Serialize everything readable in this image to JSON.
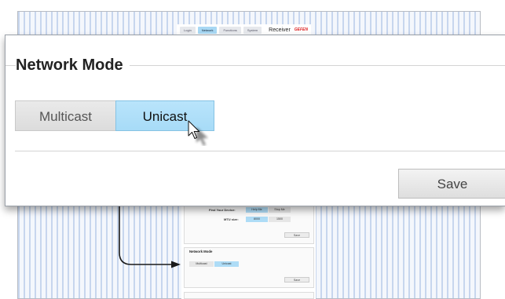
{
  "background": {
    "nav_tabs": [
      "Login",
      "Network",
      "Functions",
      "System"
    ],
    "active_tab": "Network",
    "device_label": "Receiver",
    "brand": "GEFEN",
    "find_device_label": "Find Your Device:",
    "find_device_options": [
      "Help Me",
      "Stop Me"
    ],
    "mtu_label": "MTU size:",
    "mtu_options": [
      "8000",
      "1500"
    ],
    "save_label": "Save",
    "network_mode_title": "Network Mode",
    "mode_options": [
      "Multicast",
      "Unicast"
    ],
    "selected_mode": "Unicast"
  },
  "panel": {
    "title": "Network Mode",
    "multicast_label": "Multicast",
    "unicast_label": "Unicast",
    "selected": "Unicast",
    "save_label": "Save"
  },
  "colors": {
    "selected_button": "#a7dbf7",
    "unselected_button": "#dcdcdc",
    "background_stripe": "#c7d6ee"
  },
  "icons": {
    "cursor": "mouse-pointer-icon",
    "arrow": "arrow-right-icon"
  }
}
